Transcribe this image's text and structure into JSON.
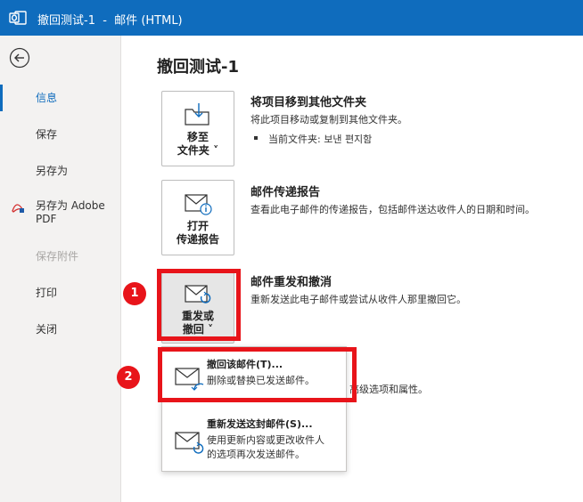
{
  "titlebar": {
    "title": "撤回测试-1  -  邮件 (HTML)"
  },
  "sidebar": {
    "items": [
      {
        "label": "信息",
        "state": "active"
      },
      {
        "label": "保存",
        "state": "normal"
      },
      {
        "label": "另存为",
        "state": "normal"
      },
      {
        "label": "另存为 Adobe\nPDF",
        "state": "normal"
      },
      {
        "label": "保存附件",
        "state": "disabled"
      },
      {
        "label": "打印",
        "state": "normal"
      },
      {
        "label": "关闭",
        "state": "normal"
      }
    ]
  },
  "main": {
    "page_title": "撤回测试-1",
    "move": {
      "tile_line1": "移至",
      "tile_line2": "文件夹 ˅",
      "title": "将项目移到其他文件夹",
      "desc": "将此项目移动或复制到其他文件夹。",
      "bullet": "当前文件夹:   보낸 편지함"
    },
    "delivery": {
      "tile_line1": "打开",
      "tile_line2": "传递报告",
      "title": "邮件传递报告",
      "desc": "查看此电子邮件的传递报告，包括邮件送达收件人的日期和时间。"
    },
    "resend": {
      "tile_line1": "重发或",
      "tile_line2": "撤回 ˅",
      "title": "邮件重发和撤消",
      "desc": "重新发送此电子邮件或尝试从收件人那里撤回它。"
    },
    "partial_hidden_text": "高级选项和属性。",
    "dropdown": {
      "recall": {
        "title": "撤回该邮件(T)...",
        "desc": "删除或替换已发送邮件。"
      },
      "resend": {
        "title": "重新发送这封邮件(S)...",
        "desc": "使用更新内容或更改收件人的选项再次发送邮件。"
      }
    }
  },
  "annotations": {
    "badge1": "1",
    "badge2": "2",
    "accent_color": "#e8141a"
  },
  "colors": {
    "titlebar": "#0f6cbd",
    "sidebar": "#f3f2f1"
  }
}
